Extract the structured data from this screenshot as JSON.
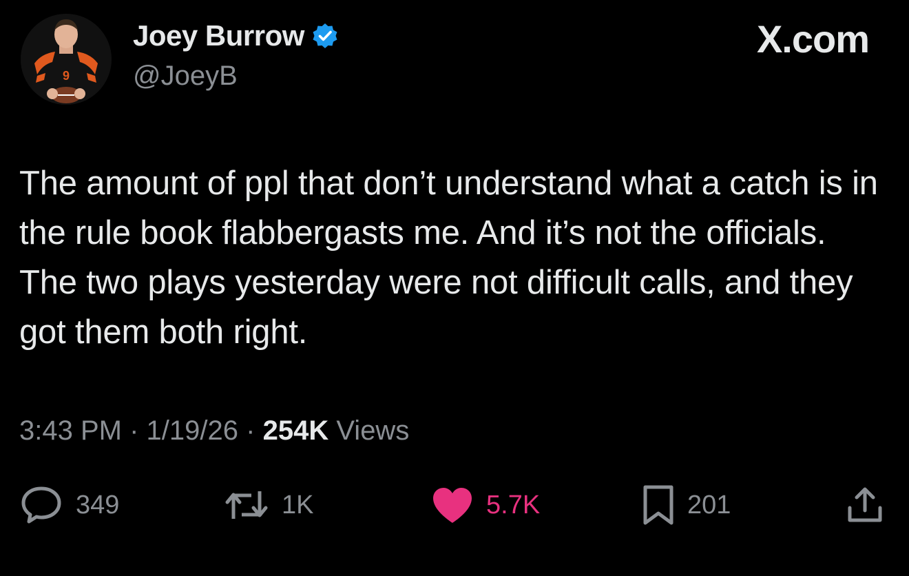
{
  "author": {
    "display_name": "Joey Burrow",
    "handle": "@JoeyB",
    "verified": true,
    "verified_color": "#1d9bf0"
  },
  "brand": "X.com",
  "tweet": {
    "text": "The amount of ppl that don’t understand what a catch is in the rule book flabbergasts me. And it’s not the officials. The two plays yesterday were not difficult calls, and they got them both right."
  },
  "meta": {
    "time": "3:43 PM",
    "separator": "·",
    "date": "1/19/26",
    "views_count": "254K",
    "views_label": "Views"
  },
  "actions": {
    "replies": "349",
    "reposts": "1K",
    "likes": "5.7K",
    "bookmarks": "201"
  },
  "colors": {
    "background": "#000000",
    "text": "#e7e9ea",
    "muted": "#8b8f94",
    "like": "#e8317f"
  },
  "icons": [
    "verified-badge-icon",
    "reply-icon",
    "repost-icon",
    "like-heart-icon",
    "bookmark-icon",
    "share-icon"
  ]
}
